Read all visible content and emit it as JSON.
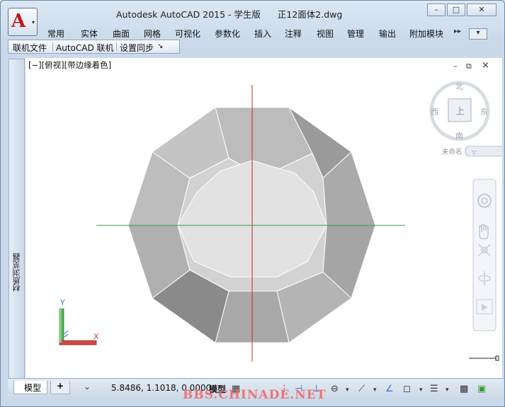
{
  "window": {
    "title": "Autodesk AutoCAD 2015 - 学生版      正12面体2.dwg",
    "controls": {
      "minimize": "–",
      "maximize": "□",
      "close": "✕"
    }
  },
  "app_menu": {
    "logo": "A",
    "caret": "▾"
  },
  "ribbon": {
    "tabs": [
      "常用",
      "实体",
      "曲面",
      "网格",
      "可视化",
      "参数化",
      "插入",
      "注释",
      "视图",
      "管理",
      "输出",
      "附加模块"
    ],
    "more": "▸▸",
    "caret": "▾"
  },
  "panel_bar": {
    "items": [
      "联机文件",
      "AutoCAD 联机",
      "设置同步"
    ],
    "pin": "↘"
  },
  "left_palette": {
    "label": "材质浏览器"
  },
  "viewport": {
    "label": "[−][俯视][带边缘着色]",
    "controls": {
      "minimize": "–",
      "restore": "⧉",
      "close": "⨯"
    }
  },
  "viewcube": {
    "north": "北",
    "south": "南",
    "east": "东",
    "west": "西",
    "face": "上",
    "ucs": "未命名"
  },
  "ucs_icon": {
    "y": "Y",
    "x": "X"
  },
  "status": {
    "model_tab": "模型",
    "add_tab": "+",
    "coords": "5.8486, 1.1018, 0.0000",
    "space": "模型"
  },
  "watermark": "BBS.CHINADE.NET",
  "colors": {
    "accent": "#c01818",
    "crosshair_v": "#c82a2a",
    "crosshair_h": "#3a9a3a"
  }
}
